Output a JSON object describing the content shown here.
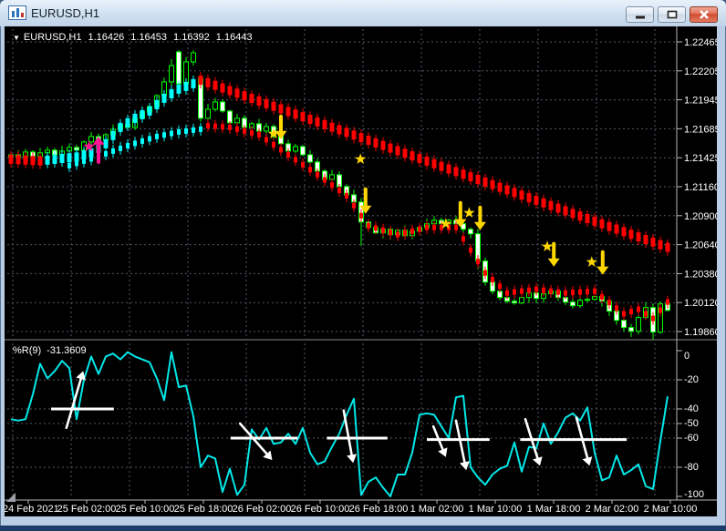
{
  "window": {
    "title": "EURUSD,H1",
    "controls": {
      "minimize": "minimize-button",
      "restore": "restore-button",
      "close": "close-button"
    }
  },
  "header": {
    "collapse_icon": "▼",
    "symbol": "EURUSD,H1",
    "open": "1.16426",
    "high": "1.16453",
    "low": "1.16392",
    "close": "1.16443"
  },
  "indicator_panel": {
    "label": "%R(9)",
    "value": "-31.3609"
  },
  "colors": {
    "background": "#000000",
    "grid": "#4f5a68",
    "axis_line": "#b8b8b8",
    "separator": "#8a8a8a",
    "text": "#ffffff",
    "candle_outline": "#00ff00",
    "bull_fill": "#000000",
    "bear_fill": "#ffffff",
    "trend_up": "#00ffff",
    "trend_down": "#ff0000",
    "signal": "#ffd700",
    "manual_signal": "#ff1493",
    "wpr_line": "#00e8e8",
    "annotation": "#ffffff",
    "grip": "#9aa0a6"
  },
  "chart_data": [
    {
      "type": "candlestick",
      "title": "EURUSD,H1",
      "y_axis": {
        "min": 1.1986,
        "max": 1.22465,
        "tick_labels": [
          "1.22465",
          "1.22205",
          "1.21945",
          "1.21685",
          "1.21425",
          "1.21160",
          "1.20900",
          "1.20640",
          "1.20380",
          "1.20120",
          "1.19860"
        ]
      },
      "x_axis": {
        "labels": [
          "24 Feb 2021",
          "25 Feb 02:00",
          "25 Feb 10:00",
          "25 Feb 18:00",
          "26 Feb 02:00",
          "26 Feb 10:00",
          "26 Feb 18:00",
          "1 Mar 02:00",
          "1 Mar 10:00",
          "1 Mar 18:00",
          "2 Mar 02:00",
          "2 Mar 10:00"
        ],
        "bars_per_label": 8
      },
      "closes": [
        1.2145,
        1.21426,
        1.21475,
        1.21434,
        1.21467,
        1.21491,
        1.2145,
        1.21483,
        1.21516,
        1.21491,
        1.21565,
        1.21614,
        1.21581,
        1.2163,
        1.21679,
        1.2172,
        1.21696,
        1.21778,
        1.21835,
        1.21884,
        1.21982,
        1.22105,
        1.22252,
        1.22088,
        1.22285,
        1.22367,
        1.21778,
        1.21859,
        1.21925,
        1.21843,
        1.21737,
        1.21778,
        1.21696,
        1.21729,
        1.21663,
        1.21704,
        1.21614,
        1.21549,
        1.21483,
        1.21524,
        1.2145,
        1.21385,
        1.21303,
        1.21229,
        1.2127,
        1.21164,
        1.2109,
        1.21025,
        1.20845,
        1.20796,
        1.20747,
        1.2078,
        1.20731,
        1.20771,
        1.20722,
        1.20763,
        1.20796,
        1.20829,
        1.20861,
        1.20829,
        1.20861,
        1.20829,
        1.2078,
        1.20739,
        1.20494,
        1.20305,
        1.20223,
        1.20166,
        1.20133,
        1.20117,
        1.20166,
        1.20207,
        1.20158,
        1.20199,
        1.20223,
        1.20166,
        1.20125,
        1.20092,
        1.20141,
        1.2015,
        1.20174,
        1.20133,
        1.20043,
        1.19961,
        1.19896,
        1.19863,
        1.19986,
        1.20076,
        1.19855,
        1.20109,
        1.20051
      ],
      "opens_override": {
        "0": 1.21432,
        "23": 1.22375,
        "26": 1.22137
      },
      "high_override": {
        "22": 1.2231,
        "23": 1.22391,
        "25": 1.2239
      },
      "low_override": {
        "26": 1.21745,
        "48": 1.2063,
        "64": 1.2042,
        "85": 1.19812,
        "88": 1.1979
      },
      "overlays": {
        "trend_major": {
          "segments": [
            {
              "color": "#ff0000",
              "points": [
                [
                  0,
                  1.2141
                ],
                [
                  4,
                  1.21394
                ]
              ]
            },
            {
              "color": "#00ffff",
              "points": [
                [
                  5,
                  1.21402
                ],
                [
                  9,
                  1.2143
                ],
                [
                  11,
                  1.21467
                ],
                [
                  13,
                  1.21549
                ],
                [
                  15,
                  1.21696
                ],
                [
                  17,
                  1.21778
                ],
                [
                  19,
                  1.21843
                ],
                [
                  21,
                  1.21958
                ],
                [
                  23,
                  1.2204
                ],
                [
                  25,
                  1.22089
                ],
                [
                  26,
                  1.22121
                ]
              ]
            },
            {
              "color": "#ff0000",
              "points": [
                [
                  26,
                  1.22121
                ],
                [
                  90,
                  1.20617
                ]
              ]
            }
          ]
        },
        "trend_minor": {
          "segments": [
            {
              "color": "#00ffff",
              "points": [
                [
                  8,
                  1.21352
                ],
                [
                  12,
                  1.21434
                ],
                [
                  16,
                  1.21532
                ],
                [
                  20,
                  1.21614
                ],
                [
                  23,
                  1.21655
                ],
                [
                  26,
                  1.2168
                ]
              ]
            },
            {
              "color": "#ff0000",
              "points": [
                [
                  27,
                  1.21712
                ],
                [
                  30,
                  1.21696
                ],
                [
                  34,
                  1.21631
                ],
                [
                  38,
                  1.2145
                ],
                [
                  42,
                  1.21271
                ],
                [
                  46,
                  1.21082
                ],
                [
                  49,
                  1.20812
                ],
                [
                  53,
                  1.20731
                ],
                [
                  57,
                  1.20796
                ],
                [
                  61,
                  1.20796
                ],
                [
                  65,
                  1.20387
                ],
                [
                  68,
                  1.20207
                ],
                [
                  72,
                  1.2024
                ],
                [
                  76,
                  1.20207
                ],
                [
                  80,
                  1.20223
                ],
                [
                  84,
                  1.20019
                ],
                [
                  86,
                  1.2006
                ],
                [
                  88,
                  1.19978
                ],
                [
                  90,
                  1.20125
                ]
              ]
            }
          ]
        }
      },
      "markers": [
        {
          "type": "star",
          "color": "#ff1493",
          "bar": 10.7,
          "price": 1.21524
        },
        {
          "type": "arrow-up",
          "color": "#ff1493",
          "bar": 12.0,
          "tip": 1.21614,
          "tail": 1.21385
        },
        {
          "type": "star",
          "color": "#ffd700",
          "bar": 36.0,
          "price": 1.21639
        },
        {
          "type": "arrow-down",
          "color": "#ffd700",
          "bar": 37.0,
          "tip": 1.2159,
          "tail": 1.21794
        },
        {
          "type": "star",
          "color": "#ffd700",
          "bar": 47.9,
          "price": 1.2141
        },
        {
          "type": "arrow-down",
          "color": "#ffd700",
          "bar": 48.6,
          "tip": 1.20919,
          "tail": 1.2114
        },
        {
          "type": "star",
          "color": "#ffd700",
          "bar": 59.6,
          "price": 1.20829
        },
        {
          "type": "arrow-down",
          "color": "#ffd700",
          "bar": 61.6,
          "tip": 1.20797,
          "tail": 1.21017
        },
        {
          "type": "star",
          "color": "#ffd700",
          "bar": 62.8,
          "price": 1.20927
        },
        {
          "type": "arrow-down",
          "color": "#ffd700",
          "bar": 64.3,
          "tip": 1.20772,
          "tail": 1.20976
        },
        {
          "type": "star",
          "color": "#ffd700",
          "bar": 73.5,
          "price": 1.20624
        },
        {
          "type": "arrow-down",
          "color": "#ffd700",
          "bar": 74.4,
          "tip": 1.20444,
          "tail": 1.20649
        },
        {
          "type": "star",
          "color": "#ffd700",
          "bar": 79.6,
          "price": 1.20485
        },
        {
          "type": "arrow-down",
          "color": "#ffd700",
          "bar": 81.1,
          "tip": 1.20371,
          "tail": 1.20575
        }
      ]
    },
    {
      "type": "line",
      "title": "%R(9)",
      "last_value": -31.3609,
      "y_range": [
        -100,
        0
      ],
      "axis_labels": [
        "0",
        "-20",
        "-40",
        "-50",
        "-60",
        "-80",
        "-100"
      ],
      "level_lines": [
        -20,
        -40,
        -50,
        -60,
        -80
      ],
      "values": [
        -47,
        -48,
        -47,
        -30,
        -9,
        -19,
        -14,
        -7,
        -12,
        -47,
        -20,
        -4,
        -16,
        -4,
        -2,
        -6,
        -1,
        -4,
        -6,
        -8,
        -19,
        -34,
        -1,
        -25,
        -24,
        -45,
        -80,
        -72,
        -74,
        -97,
        -81,
        -99,
        -92,
        -54,
        -61,
        -53,
        -64,
        -63,
        -57,
        -64,
        -53,
        -70,
        -78,
        -76,
        -66,
        -57,
        -44,
        -33,
        -99,
        -90,
        -87,
        -94,
        -100,
        -85,
        -85,
        -70,
        -44,
        -43,
        -44,
        -52,
        -60,
        -32,
        -31,
        -80,
        -87,
        -92,
        -85,
        -81,
        -79,
        -63,
        -83,
        -66,
        -67,
        -50,
        -64,
        -56,
        -46,
        -43,
        -48,
        -39,
        -70,
        -89,
        -87,
        -72,
        -85,
        -82,
        -78,
        -93,
        -95,
        -62,
        -31.36
      ],
      "annotations": {
        "hlines": [
          {
            "from": 5.5,
            "to": 14.1,
            "level": -40
          },
          {
            "from": 30.1,
            "to": 39.3,
            "level": -60
          },
          {
            "from": 43.3,
            "to": 51.6,
            "level": -60
          },
          {
            "from": 57.0,
            "to": 65.6,
            "level": -61
          },
          {
            "from": 69.8,
            "to": 84.4,
            "level": -61
          }
        ],
        "arrows": [
          {
            "dir": "up",
            "from": [
              7.6,
              -53
            ],
            "to": [
              9.9,
              -14
            ]
          },
          {
            "dir": "down",
            "from": [
              31.4,
              -50
            ],
            "to": [
              35.8,
              -75
            ]
          },
          {
            "dir": "down",
            "from": [
              45.6,
              -41
            ],
            "to": [
              46.9,
              -77
            ]
          },
          {
            "dir": "down",
            "from": [
              57.9,
              -52
            ],
            "to": [
              59.6,
              -73
            ]
          },
          {
            "dir": "down",
            "from": [
              61.0,
              -48
            ],
            "to": [
              62.4,
              -82
            ]
          },
          {
            "dir": "down",
            "from": [
              70.5,
              -47
            ],
            "to": [
              72.5,
              -79
            ]
          },
          {
            "dir": "down",
            "from": [
              77.5,
              -46
            ],
            "to": [
              79.3,
              -79
            ]
          }
        ]
      }
    }
  ]
}
